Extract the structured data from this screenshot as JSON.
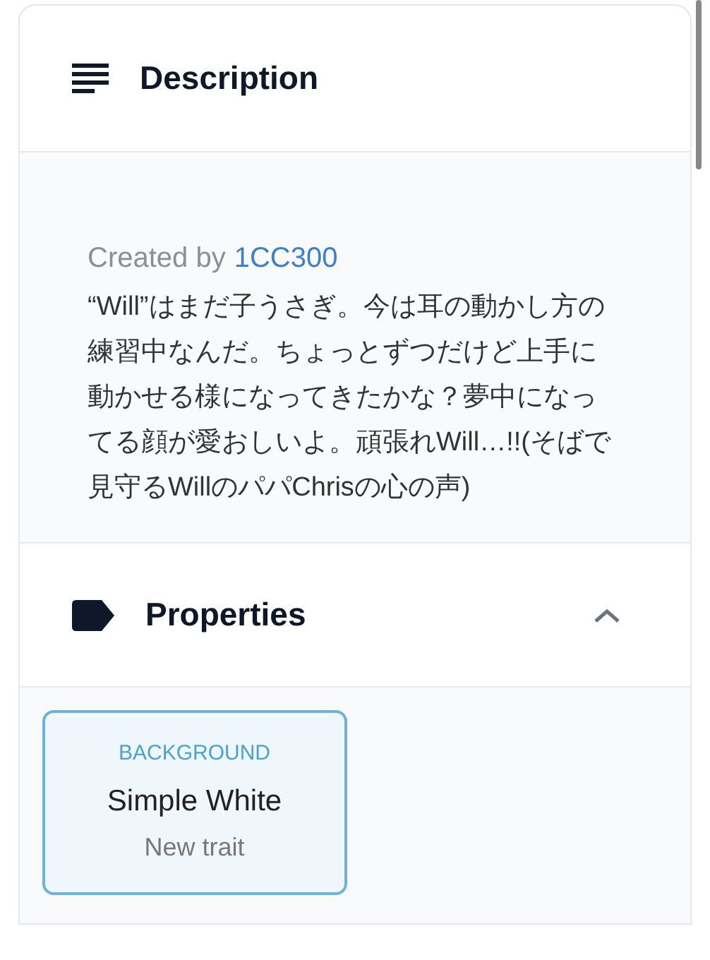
{
  "description": {
    "title": "Description",
    "created_by_label": "Created by",
    "creator": "1CC300",
    "text": "“Will”はまだ子うさぎ。今は耳の動かし方の練習中なんだ。ちょっとずつだけど上手に動かせる様になってきたかな？夢中になってる顔が愛おしいよ。頑張れWill…!!(そばで見守るWillのパパChrisの心の声)"
  },
  "properties": {
    "title": "Properties",
    "expanded": true,
    "traits": [
      {
        "type": "BACKGROUND",
        "value": "Simple White",
        "rarity": "New trait"
      }
    ]
  }
}
